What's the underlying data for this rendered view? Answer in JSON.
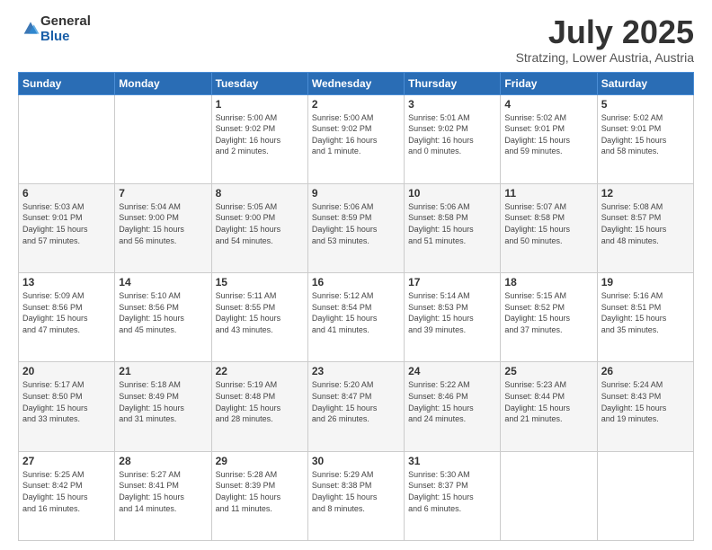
{
  "header": {
    "logo": {
      "general": "General",
      "blue": "Blue"
    },
    "title": "July 2025",
    "location": "Stratzing, Lower Austria, Austria"
  },
  "weekdays": [
    "Sunday",
    "Monday",
    "Tuesday",
    "Wednesday",
    "Thursday",
    "Friday",
    "Saturday"
  ],
  "weeks": [
    [
      {
        "day": "",
        "info": ""
      },
      {
        "day": "",
        "info": ""
      },
      {
        "day": "1",
        "info": "Sunrise: 5:00 AM\nSunset: 9:02 PM\nDaylight: 16 hours\nand 2 minutes."
      },
      {
        "day": "2",
        "info": "Sunrise: 5:00 AM\nSunset: 9:02 PM\nDaylight: 16 hours\nand 1 minute."
      },
      {
        "day": "3",
        "info": "Sunrise: 5:01 AM\nSunset: 9:02 PM\nDaylight: 16 hours\nand 0 minutes."
      },
      {
        "day": "4",
        "info": "Sunrise: 5:02 AM\nSunset: 9:01 PM\nDaylight: 15 hours\nand 59 minutes."
      },
      {
        "day": "5",
        "info": "Sunrise: 5:02 AM\nSunset: 9:01 PM\nDaylight: 15 hours\nand 58 minutes."
      }
    ],
    [
      {
        "day": "6",
        "info": "Sunrise: 5:03 AM\nSunset: 9:01 PM\nDaylight: 15 hours\nand 57 minutes."
      },
      {
        "day": "7",
        "info": "Sunrise: 5:04 AM\nSunset: 9:00 PM\nDaylight: 15 hours\nand 56 minutes."
      },
      {
        "day": "8",
        "info": "Sunrise: 5:05 AM\nSunset: 9:00 PM\nDaylight: 15 hours\nand 54 minutes."
      },
      {
        "day": "9",
        "info": "Sunrise: 5:06 AM\nSunset: 8:59 PM\nDaylight: 15 hours\nand 53 minutes."
      },
      {
        "day": "10",
        "info": "Sunrise: 5:06 AM\nSunset: 8:58 PM\nDaylight: 15 hours\nand 51 minutes."
      },
      {
        "day": "11",
        "info": "Sunrise: 5:07 AM\nSunset: 8:58 PM\nDaylight: 15 hours\nand 50 minutes."
      },
      {
        "day": "12",
        "info": "Sunrise: 5:08 AM\nSunset: 8:57 PM\nDaylight: 15 hours\nand 48 minutes."
      }
    ],
    [
      {
        "day": "13",
        "info": "Sunrise: 5:09 AM\nSunset: 8:56 PM\nDaylight: 15 hours\nand 47 minutes."
      },
      {
        "day": "14",
        "info": "Sunrise: 5:10 AM\nSunset: 8:56 PM\nDaylight: 15 hours\nand 45 minutes."
      },
      {
        "day": "15",
        "info": "Sunrise: 5:11 AM\nSunset: 8:55 PM\nDaylight: 15 hours\nand 43 minutes."
      },
      {
        "day": "16",
        "info": "Sunrise: 5:12 AM\nSunset: 8:54 PM\nDaylight: 15 hours\nand 41 minutes."
      },
      {
        "day": "17",
        "info": "Sunrise: 5:14 AM\nSunset: 8:53 PM\nDaylight: 15 hours\nand 39 minutes."
      },
      {
        "day": "18",
        "info": "Sunrise: 5:15 AM\nSunset: 8:52 PM\nDaylight: 15 hours\nand 37 minutes."
      },
      {
        "day": "19",
        "info": "Sunrise: 5:16 AM\nSunset: 8:51 PM\nDaylight: 15 hours\nand 35 minutes."
      }
    ],
    [
      {
        "day": "20",
        "info": "Sunrise: 5:17 AM\nSunset: 8:50 PM\nDaylight: 15 hours\nand 33 minutes."
      },
      {
        "day": "21",
        "info": "Sunrise: 5:18 AM\nSunset: 8:49 PM\nDaylight: 15 hours\nand 31 minutes."
      },
      {
        "day": "22",
        "info": "Sunrise: 5:19 AM\nSunset: 8:48 PM\nDaylight: 15 hours\nand 28 minutes."
      },
      {
        "day": "23",
        "info": "Sunrise: 5:20 AM\nSunset: 8:47 PM\nDaylight: 15 hours\nand 26 minutes."
      },
      {
        "day": "24",
        "info": "Sunrise: 5:22 AM\nSunset: 8:46 PM\nDaylight: 15 hours\nand 24 minutes."
      },
      {
        "day": "25",
        "info": "Sunrise: 5:23 AM\nSunset: 8:44 PM\nDaylight: 15 hours\nand 21 minutes."
      },
      {
        "day": "26",
        "info": "Sunrise: 5:24 AM\nSunset: 8:43 PM\nDaylight: 15 hours\nand 19 minutes."
      }
    ],
    [
      {
        "day": "27",
        "info": "Sunrise: 5:25 AM\nSunset: 8:42 PM\nDaylight: 15 hours\nand 16 minutes."
      },
      {
        "day": "28",
        "info": "Sunrise: 5:27 AM\nSunset: 8:41 PM\nDaylight: 15 hours\nand 14 minutes."
      },
      {
        "day": "29",
        "info": "Sunrise: 5:28 AM\nSunset: 8:39 PM\nDaylight: 15 hours\nand 11 minutes."
      },
      {
        "day": "30",
        "info": "Sunrise: 5:29 AM\nSunset: 8:38 PM\nDaylight: 15 hours\nand 8 minutes."
      },
      {
        "day": "31",
        "info": "Sunrise: 5:30 AM\nSunset: 8:37 PM\nDaylight: 15 hours\nand 6 minutes."
      },
      {
        "day": "",
        "info": ""
      },
      {
        "day": "",
        "info": ""
      }
    ]
  ]
}
